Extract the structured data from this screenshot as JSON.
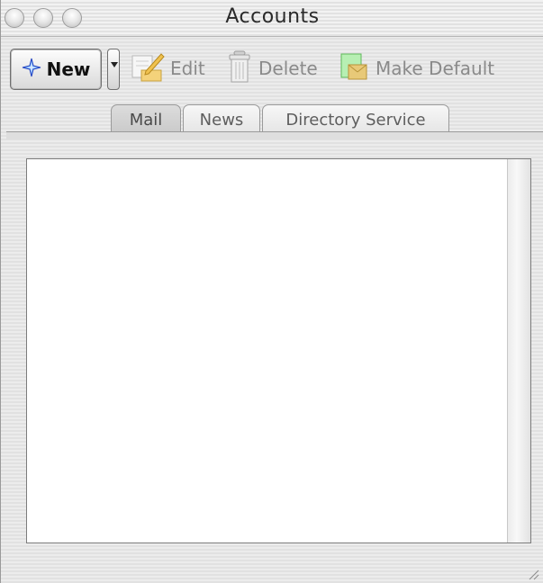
{
  "window": {
    "title": "Accounts"
  },
  "toolbar": {
    "new_label": "New",
    "edit_label": "Edit",
    "delete_label": "Delete",
    "make_default_label": "Make Default",
    "icons": {
      "new": "sparkle-star-icon",
      "edit": "edit-pencil-icon",
      "delete": "trash-can-icon",
      "make_default": "default-document-icon",
      "dropdown": "triangle-down-icon"
    }
  },
  "tabs": [
    {
      "label": "Mail",
      "active": true
    },
    {
      "label": "News",
      "active": false
    },
    {
      "label": "Directory Service",
      "active": false
    }
  ],
  "accounts_list": {
    "items": []
  }
}
